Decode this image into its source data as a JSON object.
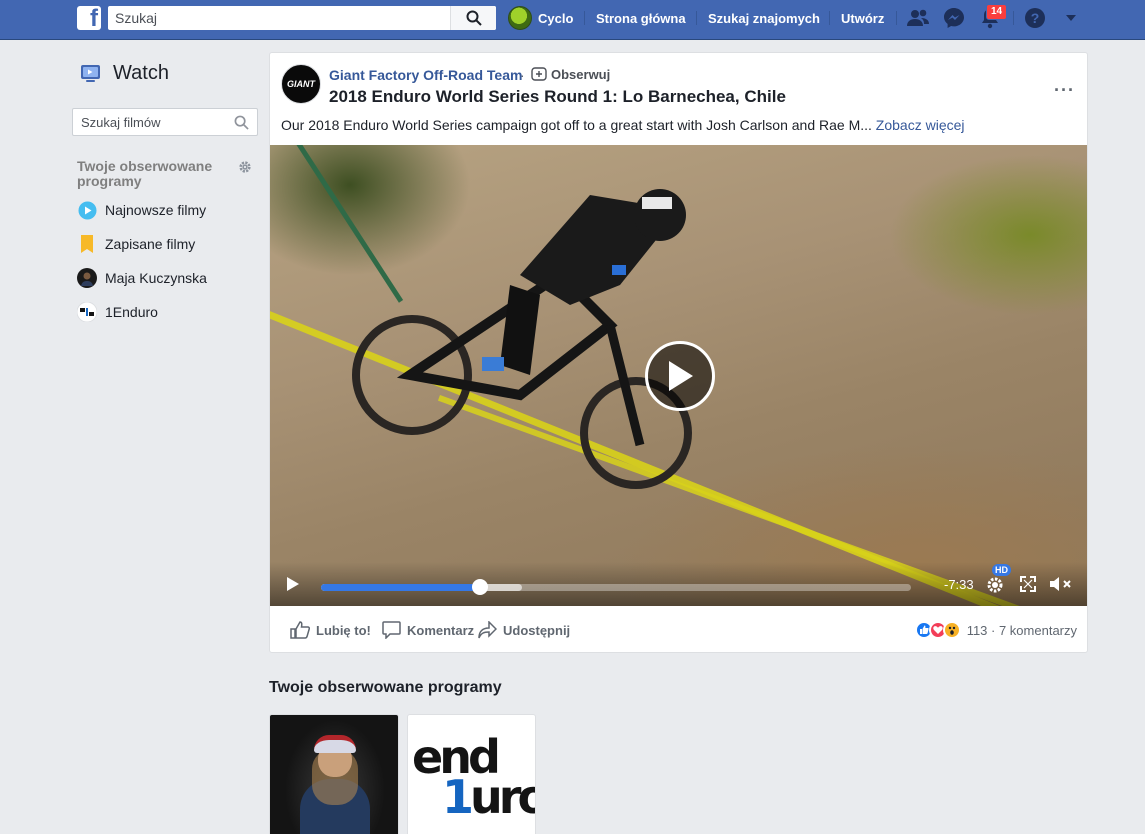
{
  "topbar": {
    "logo": "f",
    "search_placeholder": "Szukaj",
    "profile_name": "Cyclo",
    "home": "Strona główna",
    "find_friends": "Szukaj znajomych",
    "create": "Utwórz",
    "notifications_count": "14",
    "icons": [
      "search-icon",
      "friends-icon",
      "messenger-icon",
      "bell-icon",
      "help-icon",
      "chevron-down-icon"
    ]
  },
  "sidebar": {
    "title": "Watch",
    "search_placeholder": "Szukaj filmów",
    "section_title": "Twoje obserwowane programy",
    "items": [
      {
        "label": "Najnowsze filmy",
        "icon": "play-circle-icon"
      },
      {
        "label": "Zapisane filmy",
        "icon": "bookmark-icon"
      },
      {
        "label": "Maja Kuczynska",
        "icon": "avatar"
      },
      {
        "label": "1Enduro",
        "icon": "avatar"
      }
    ]
  },
  "post": {
    "page_name": "Giant Factory Off-Road Team",
    "page_logo_text": "GIANT",
    "separator": "·",
    "follow_label": "Obserwuj",
    "title": "2018 Enduro World Series Round 1: Lo Barnechea, Chile",
    "description": "Our 2018 Enduro World Series campaign got off to a great start with Josh Carlson and Rae M...",
    "see_more": "Zobacz więcej",
    "video": {
      "time_remaining": "-7:33",
      "quality": "HD",
      "progress_played": 0.27,
      "progress_buffered": 0.34
    },
    "actions": {
      "like": "Lubię to!",
      "comment": "Komentarz",
      "share": "Udostępnij"
    },
    "reactions": {
      "types": [
        "like",
        "love",
        "wow"
      ],
      "colors": {
        "like": "#1877f2",
        "love": "#f33e58",
        "wow": "#f7b125"
      },
      "summary": "113 · 7 komentarzy"
    }
  },
  "followed": {
    "title": "Twoje obserwowane programy",
    "shows": [
      {
        "name": "Maja Kuczynska"
      },
      {
        "name": "1Enduro",
        "logo_line1": "end",
        "logo_one": "1",
        "logo_line2": "uro"
      }
    ]
  },
  "colors": {
    "brand": "#4267b2",
    "link": "#365899",
    "background": "#e9ebee"
  }
}
